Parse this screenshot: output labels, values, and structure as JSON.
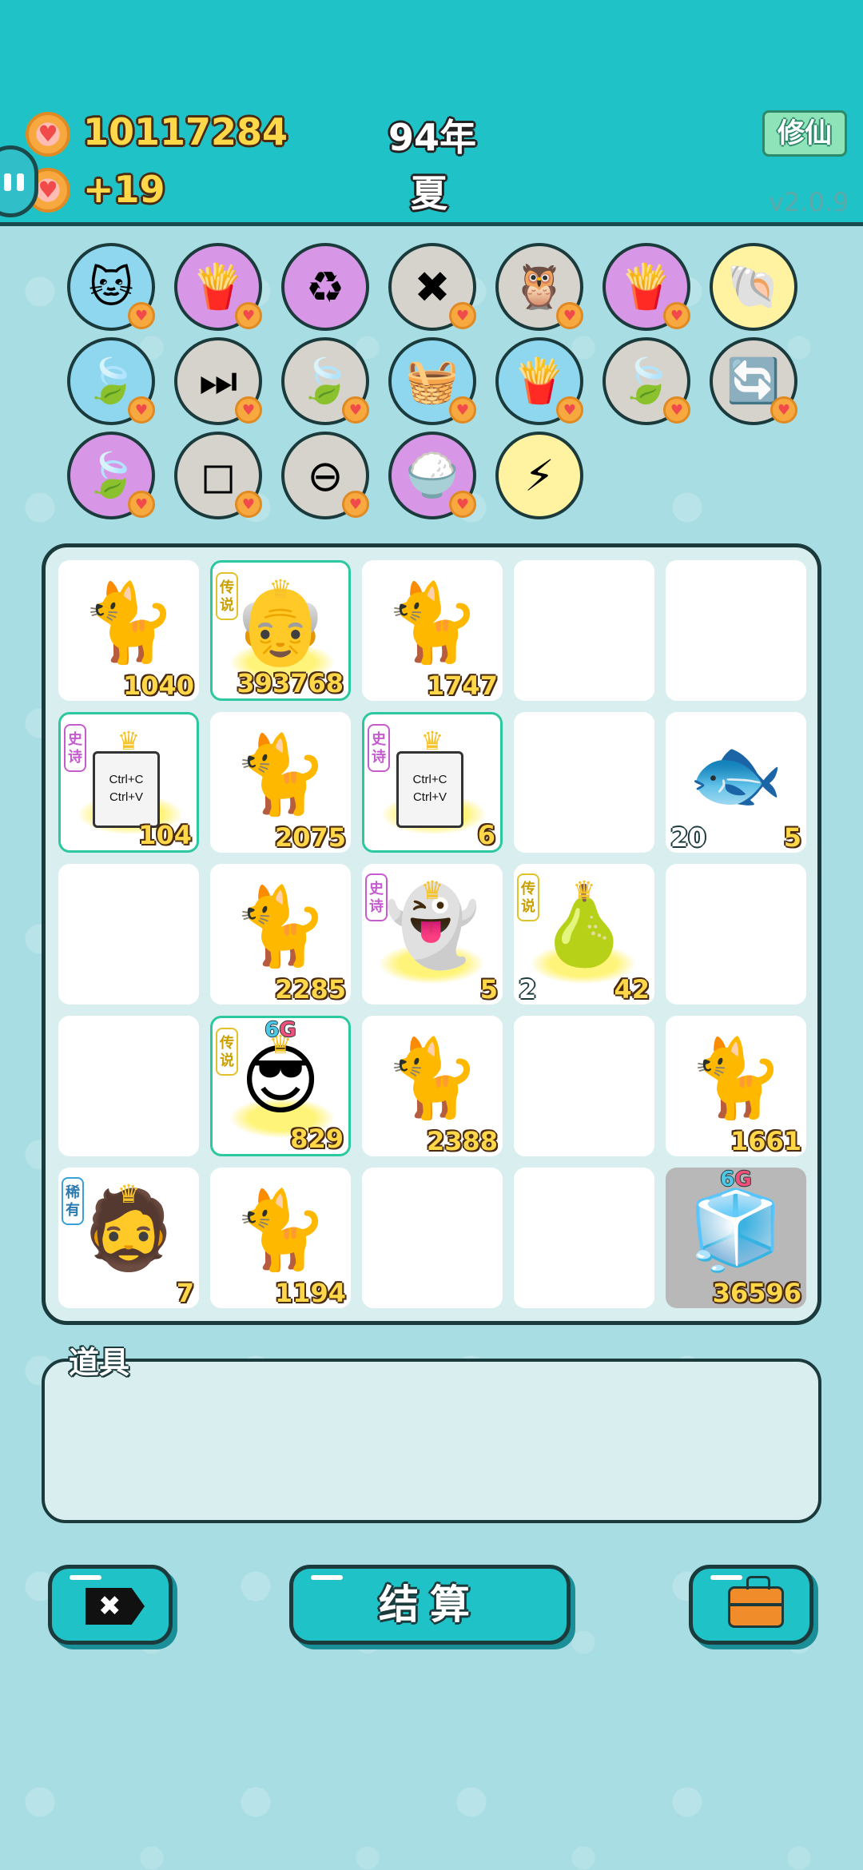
{
  "header": {
    "coins": "10117284",
    "income": "+19",
    "year": "94年",
    "season": "夏",
    "mode_button": "修仙",
    "version": "v2.0.9"
  },
  "symbol_icons": [
    {
      "name": "cat",
      "glyph": "🐱",
      "bg": "blue",
      "badge": true
    },
    {
      "name": "fries",
      "glyph": "🍟",
      "bg": "purple",
      "badge": true
    },
    {
      "name": "recycle",
      "glyph": "♻",
      "bg": "purple",
      "badge": false
    },
    {
      "name": "remove-tag",
      "glyph": "✖",
      "bg": "grey",
      "badge": true
    },
    {
      "name": "owls",
      "glyph": "🦉",
      "bg": "grey",
      "badge": true
    },
    {
      "name": "fries",
      "glyph": "🍟",
      "bg": "purple",
      "badge": true
    },
    {
      "name": "shell",
      "glyph": "🐚",
      "bg": "yellow",
      "badge": false
    },
    {
      "name": "leaf",
      "glyph": "🍃",
      "bg": "blue",
      "badge": true
    },
    {
      "name": "skip",
      "glyph": "⏭",
      "bg": "grey",
      "badge": true
    },
    {
      "name": "leaf",
      "glyph": "🍃",
      "bg": "grey",
      "badge": true
    },
    {
      "name": "fruit-basket",
      "glyph": "🧺",
      "bg": "blue",
      "badge": true
    },
    {
      "name": "fries",
      "glyph": "🍟",
      "bg": "blue",
      "badge": true
    },
    {
      "name": "leaf",
      "glyph": "🍃",
      "bg": "grey",
      "badge": true
    },
    {
      "name": "refresh",
      "glyph": "🔄",
      "bg": "grey",
      "badge": true
    },
    {
      "name": "leaf",
      "glyph": "🍃",
      "bg": "purple",
      "badge": true
    },
    {
      "name": "sugar-cubes",
      "glyph": "◻",
      "bg": "grey",
      "badge": true
    },
    {
      "name": "minus",
      "glyph": "⊖",
      "bg": "grey",
      "badge": true
    },
    {
      "name": "rice-bowl",
      "glyph": "🍚",
      "bg": "purple",
      "badge": true
    },
    {
      "name": "lightning",
      "glyph": "⚡",
      "bg": "yellow",
      "badge": false
    }
  ],
  "board": [
    {
      "kind": "cat",
      "value": "1040"
    },
    {
      "kind": "grandpa",
      "value": "393768",
      "tag": "传说",
      "tag_type": "legend",
      "glow": true
    },
    {
      "kind": "cat",
      "value": "1747"
    },
    {
      "kind": "empty"
    },
    {
      "kind": "empty"
    },
    {
      "kind": "ctrl",
      "value": "104",
      "tag": "史诗",
      "tag_type": "epic",
      "glow": true,
      "line1": "Ctrl+C",
      "line2": "Ctrl+V"
    },
    {
      "kind": "cat",
      "value": "2075"
    },
    {
      "kind": "ctrl",
      "value": "6",
      "tag": "史诗",
      "tag_type": "epic",
      "glow": true,
      "line1": "Ctrl+C",
      "line2": "Ctrl+V"
    },
    {
      "kind": "empty"
    },
    {
      "kind": "fish",
      "value": "5",
      "left": "20"
    },
    {
      "kind": "empty"
    },
    {
      "kind": "cat",
      "value": "2285"
    },
    {
      "kind": "ghost",
      "value": "5",
      "tag": "史诗",
      "tag_type": "epic"
    },
    {
      "kind": "pear",
      "value": "42",
      "tag": "传说",
      "tag_type": "legend",
      "left": "2"
    },
    {
      "kind": "empty"
    },
    {
      "kind": "empty"
    },
    {
      "kind": "sunglasses",
      "value": "829",
      "tag": "传说",
      "tag_type": "legend",
      "glow": true,
      "gtag": true
    },
    {
      "kind": "cat",
      "value": "2388"
    },
    {
      "kind": "empty"
    },
    {
      "kind": "cat",
      "value": "1661"
    },
    {
      "kind": "hatman",
      "value": "7",
      "tag": "稀有",
      "tag_type": "rare"
    },
    {
      "kind": "cat",
      "value": "1194"
    },
    {
      "kind": "empty"
    },
    {
      "kind": "empty"
    },
    {
      "kind": "fridge",
      "value": "36596",
      "grey": true,
      "gtag": true
    }
  ],
  "gtag": {
    "six": "6",
    "g": "G"
  },
  "tools": {
    "label": "道具"
  },
  "buttons": {
    "discard_glyph": "✖",
    "settle": "结算"
  }
}
